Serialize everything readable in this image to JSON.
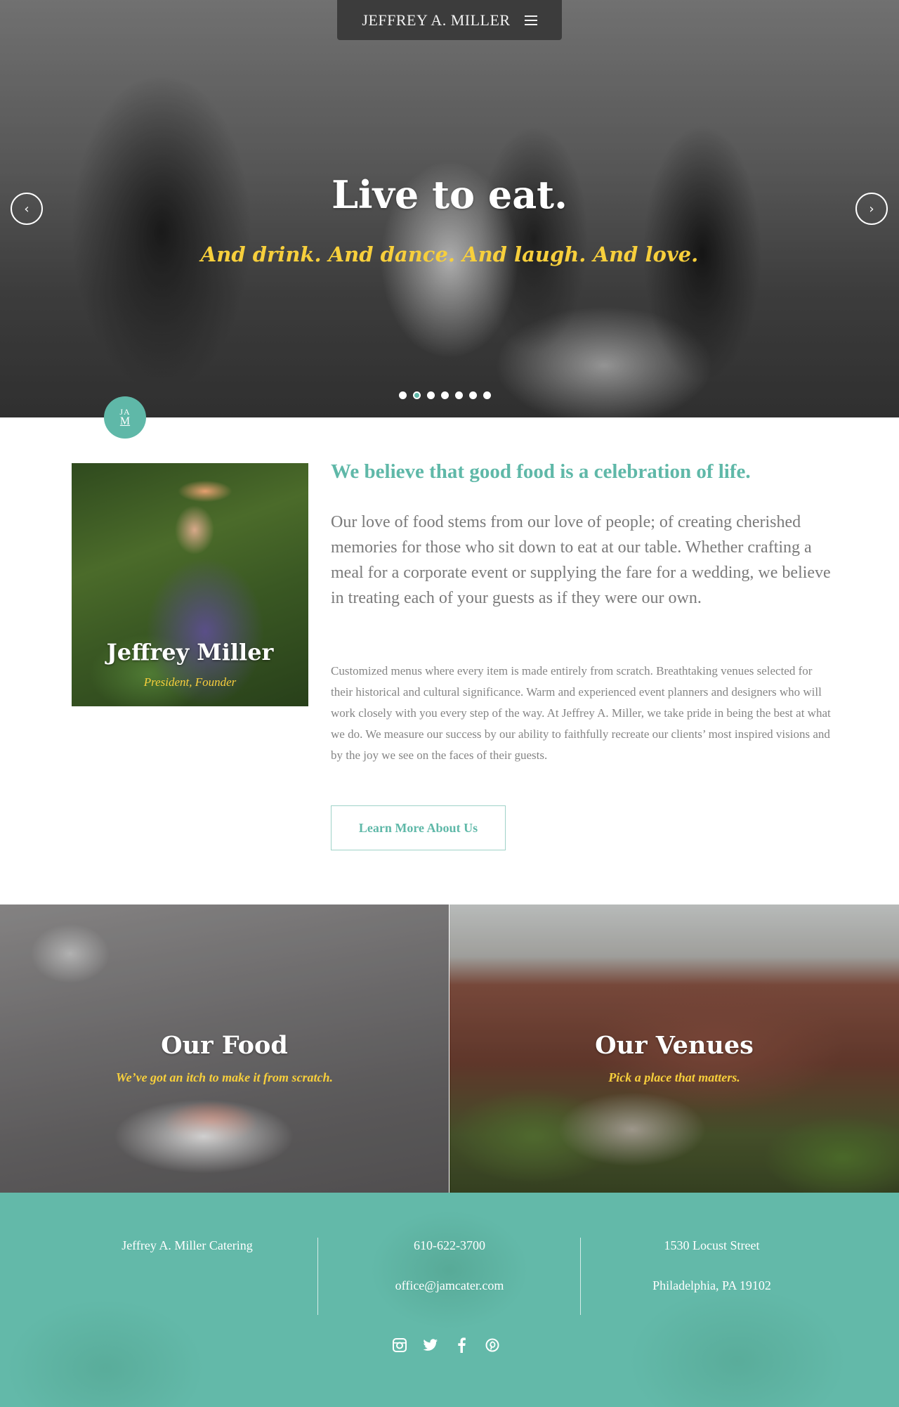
{
  "nav": {
    "brand": "JEFFREY A. MILLER"
  },
  "hero": {
    "title": "Live to eat.",
    "subtitle": "And drink. And dance. And laugh. And love.",
    "prev_label": "‹",
    "next_label": "›",
    "slide_count": 7,
    "active_slide": 2
  },
  "badge": {
    "line1": "JA",
    "line2": "M"
  },
  "about": {
    "portrait_name": "Jeffrey Miller",
    "portrait_role": "President, Founder",
    "headline": "We believe that good food is a celebration of life.",
    "lead": "Our love of food stems from our love of people; of creating cherished memories for those who sit down to eat at our table. Whether crafting a meal for a corporate event or supplying the fare for a wedding, we believe in treating each of your guests as if they were our own.",
    "body": "Customized menus where every item is made entirely from scratch. Breathtaking venues selected for their historical and cultural significance. Warm and experienced event planners and designers who will work closely with you every step of the way. At Jeffrey A. Miller, we take pride in being the best at what we do. We measure our success by our ability to faithfully recreate our clients’ most inspired visions and by the joy we see on the faces of their guests.",
    "button_label": "Learn More About Us"
  },
  "tiles": {
    "food": {
      "title": "Our Food",
      "subtitle": "We’ve got an itch to make it from scratch."
    },
    "venues": {
      "title": "Our Venues",
      "subtitle": "Pick a place that matters."
    }
  },
  "footer": {
    "company": "Jeffrey A. Miller Catering",
    "phone": "610-622-3700",
    "email": "office@jamcater.com",
    "street": "1530 Locust Street",
    "city": "Philadelphia, PA 19102",
    "social": [
      "instagram-icon",
      "twitter-icon",
      "facebook-icon",
      "pinterest-icon"
    ]
  },
  "colors": {
    "accent": "#5fb8a8",
    "highlight": "#f7cf3c",
    "footer_bg": "#63b9a9"
  }
}
